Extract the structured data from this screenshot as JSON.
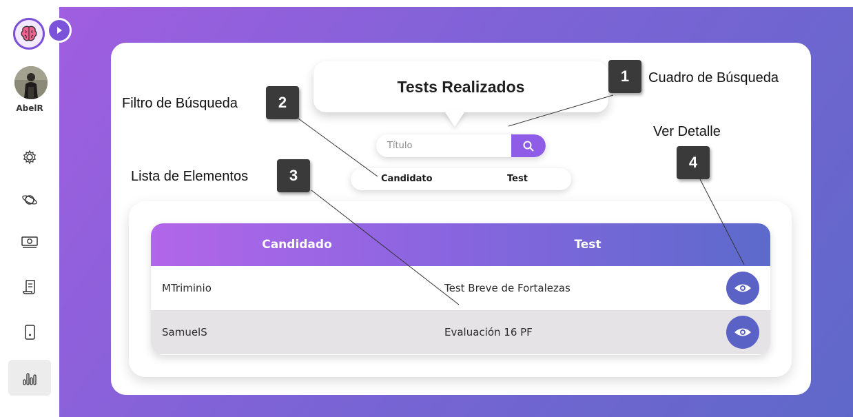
{
  "sidebar": {
    "user_name": "AbelR",
    "nav_icons": [
      "gear-icon",
      "planet-icon",
      "cash-icon",
      "scroll-icon",
      "phone-icon",
      "bar-chart-icon"
    ],
    "active_item": "bar-chart-icon"
  },
  "header": {
    "title": "Tests Realizados"
  },
  "search": {
    "placeholder": "Título"
  },
  "filters": {
    "candidate": "Candidato",
    "test": "Test"
  },
  "table": {
    "columns": [
      "Candidado",
      "Test"
    ],
    "rows": [
      {
        "candidate": "MTriminio",
        "test": "Test Breve de Fortalezas"
      },
      {
        "candidate": "SamuelS",
        "test": "Evaluación 16 PF"
      }
    ]
  },
  "callouts": [
    {
      "number": "1",
      "label": "Cuadro de Búsqueda"
    },
    {
      "number": "2",
      "label": "Filtro de Búsqueda"
    },
    {
      "number": "3",
      "label": "Lista de Elementos"
    },
    {
      "number": "4",
      "label": "Ver Detalle"
    }
  ],
  "colors": {
    "accent": "#8e5ce6",
    "eye_button": "#5b62c6",
    "gradient_start": "#a05ee0",
    "gradient_end": "#5f68c9"
  }
}
